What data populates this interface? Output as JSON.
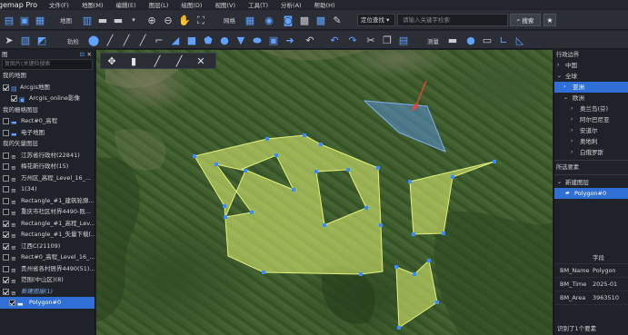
{
  "menubar": {
    "app_title": "gemap Pro",
    "items": [
      "文件(F)",
      "地图(M)",
      "编辑(E)",
      "图层(L)",
      "绘图(D)",
      "视图(V)",
      "工具(T)",
      "分析(A)",
      "帮助(H)"
    ]
  },
  "toolbar1": {
    "map_label": "地图",
    "grid_label": "网格",
    "search_mode": "定位查找",
    "search_placeholder": "请输入关键字检索",
    "search_button": "搜索"
  },
  "toolbar2": {
    "trajectory_label": "轨检",
    "measure_label": "测量"
  },
  "left_panel": {
    "title": "图",
    "search_placeholder": "复图片(关键检搜索",
    "sections": {
      "my_maps": "我的地图",
      "raster_layers": "我的栅格图层",
      "vector_layers": "我的矢量图层"
    },
    "items": [
      {
        "label": "Arcgis地图",
        "checked": true
      },
      {
        "label": "Arcgis_online影像",
        "checked": true
      },
      {
        "label": "Rect#0_高程",
        "checked": false
      },
      {
        "label": "电子地图",
        "checked": false
      },
      {
        "label": "江苏省行政村(22841)",
        "checked": false
      },
      {
        "label": "梅花新行政村(15)",
        "checked": false
      },
      {
        "label": "万州区_高程_Level_16_...",
        "checked": false
      },
      {
        "label": "1(34)",
        "checked": false
      },
      {
        "label": "Rectangle_#1_建筑轮廓...",
        "checked": false
      },
      {
        "label": "重庆市社区村界4490-既...",
        "checked": false
      },
      {
        "label": "Rectangle_#1_高程_Lev...",
        "checked": true
      },
      {
        "label": "Rectangle_#1_矢量下载(...",
        "checked": true
      },
      {
        "label": "江西C(21109)",
        "checked": true
      },
      {
        "label": "Rect#0_高程_Level_16_...",
        "checked": false
      },
      {
        "label": "贵州省各村居界4490(51)...",
        "checked": false
      },
      {
        "label": "范围(中山区)(8)",
        "checked": true
      },
      {
        "label": "新建图层(1)",
        "checked": true
      },
      {
        "label": "Polygon#0",
        "checked": true
      }
    ]
  },
  "right_panel": {
    "admin_title": "行政边界",
    "admin_tree": [
      {
        "label": "中国",
        "level": 0,
        "expanded": false
      },
      {
        "label": "全球",
        "level": 0,
        "expanded": true
      },
      {
        "label": "亚洲",
        "level": 1,
        "expanded": false,
        "selected": true
      },
      {
        "label": "欧洲",
        "level": 1,
        "expanded": true
      },
      {
        "label": "奥兰岛(芬)",
        "level": 2
      },
      {
        "label": "阿尔巴尼亚",
        "level": 2
      },
      {
        "label": "安道尔",
        "level": 2
      },
      {
        "label": "奥地利",
        "level": 2
      },
      {
        "label": "白俄罗斯",
        "level": 2
      }
    ],
    "selected_title": "所选要素",
    "selected_tree": [
      {
        "label": "新建图层",
        "level": 0
      },
      {
        "label": "Polygon#0",
        "level": 1,
        "selected": true
      }
    ],
    "attr_header": "字段",
    "attributes": [
      {
        "key": "BM_Name",
        "value": "Polygon"
      },
      {
        "key": "BM_Time",
        "value": "2025-01"
      },
      {
        "key": "BM_Area",
        "value": "3963510"
      }
    ],
    "status": "识别了1个要素"
  },
  "colors": {
    "polygon_fill": "#d7eb6e",
    "polygon_stroke": "#e3f27a",
    "vertex": "#3b8bff",
    "selected_blue": "#5a8fd4",
    "highlight": "#2f6fd6",
    "arrow_red": "#e0473a"
  },
  "icons": {
    "toolbar1": [
      "layer-icon",
      "image-icon",
      "grid-icon",
      "map-icon",
      "zoom-in-icon",
      "zoom-out-icon",
      "pan-icon",
      "fullscreen-icon",
      "globe-icon",
      "camera-icon",
      "color-icon",
      "brush-icon"
    ],
    "toolbar2": [
      "select-icon",
      "point-icon",
      "line-icon",
      "curve-icon",
      "rect-icon",
      "polygon-icon",
      "circle-icon",
      "text-icon",
      "undo-icon",
      "redo-icon",
      "cut-icon",
      "copy-icon",
      "paste-icon"
    ]
  }
}
